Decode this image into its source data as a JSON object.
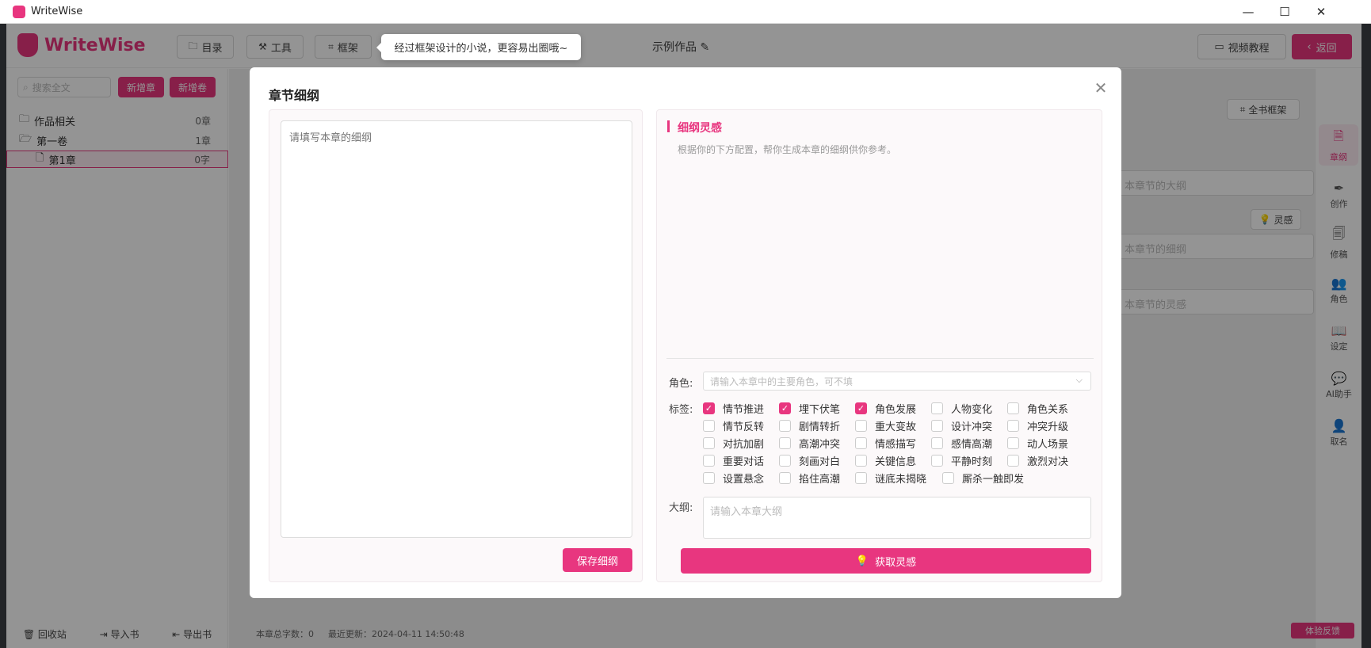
{
  "window": {
    "title": "WriteWise",
    "minimize": "—",
    "maximize": "☐",
    "close": "✕"
  },
  "header": {
    "brand": "WriteWise",
    "catalog": "目录",
    "tools": "工具",
    "framework": "框架",
    "work_title": "示例作品",
    "video_tutorial": "视频教程",
    "back": "返回"
  },
  "tooltip": {
    "text": "经过框架设计的小说，更容易出圈哦~"
  },
  "sidebar": {
    "search_placeholder": "搜索全文",
    "new_chapter": "新增章",
    "new_volume": "新增卷",
    "tree": [
      {
        "label": "作品相关",
        "count": "0章"
      },
      {
        "label": "第一卷",
        "count": "1章"
      },
      {
        "label": "第1章",
        "count": "0字"
      }
    ],
    "footer": {
      "recycle": "回收站",
      "import": "导入书",
      "export": "导出书"
    }
  },
  "right_panel": {
    "full_framework": "全书框架",
    "inspiration": "灵感",
    "field1_placeholder": "本章节的大纲",
    "field2_placeholder": "本章节的细纲",
    "field3_placeholder": "本章节的灵感"
  },
  "rail": [
    {
      "label": "章纲"
    },
    {
      "label": "创作"
    },
    {
      "label": "修稿"
    },
    {
      "label": "角色"
    },
    {
      "label": "设定"
    },
    {
      "label": "AI助手"
    },
    {
      "label": "取名"
    }
  ],
  "statusbar": {
    "word_count": "本章总字数：0",
    "updated": "最近更新：2024-04-11 14:50:48"
  },
  "feedback": "体验反馈",
  "modal": {
    "title": "章节细纲",
    "outline_placeholder": "请填写本章的细纲",
    "save_button": "保存细纲",
    "section_title": "细纲灵感",
    "section_desc": "根据你的下方配置，帮你生成本章的细纲供你参考。",
    "role_label": "角色:",
    "role_placeholder": "请输入本章中的主要角色，可不填",
    "tags_label": "标签:",
    "tags": [
      {
        "label": "情节推进",
        "checked": true
      },
      {
        "label": "埋下伏笔",
        "checked": true
      },
      {
        "label": "角色发展",
        "checked": true
      },
      {
        "label": "人物变化",
        "checked": false
      },
      {
        "label": "角色关系",
        "checked": false
      },
      {
        "label": "情节反转",
        "checked": false
      },
      {
        "label": "剧情转折",
        "checked": false
      },
      {
        "label": "重大变故",
        "checked": false
      },
      {
        "label": "设计冲突",
        "checked": false
      },
      {
        "label": "冲突升级",
        "checked": false
      },
      {
        "label": "对抗加剧",
        "checked": false
      },
      {
        "label": "高潮冲突",
        "checked": false
      },
      {
        "label": "情感描写",
        "checked": false
      },
      {
        "label": "感情高潮",
        "checked": false
      },
      {
        "label": "动人场景",
        "checked": false
      },
      {
        "label": "重要对话",
        "checked": false
      },
      {
        "label": "刻画对白",
        "checked": false
      },
      {
        "label": "关键信息",
        "checked": false
      },
      {
        "label": "平静时刻",
        "checked": false
      },
      {
        "label": "激烈对决",
        "checked": false
      },
      {
        "label": "设置悬念",
        "checked": false
      },
      {
        "label": "掐住高潮",
        "checked": false
      },
      {
        "label": "谜底未揭晓",
        "checked": false
      },
      {
        "label": "厮杀一触即发",
        "checked": false
      }
    ],
    "outline_label": "大纲:",
    "outline_input_placeholder": "请输入本章大纲",
    "inspire_button": "获取灵感"
  },
  "colors": {
    "accent": "#e8367f"
  }
}
